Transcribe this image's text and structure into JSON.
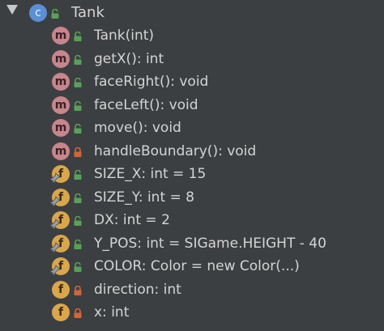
{
  "colors": {
    "background": "#3c3f41",
    "class_badge": "#5b8fd6",
    "method_badge": "#c8858c",
    "field_badge": "#d9a64c",
    "public_lock": "#58a158",
    "private_lock": "#d2663a",
    "text": "#d4d4d4"
  },
  "tree": {
    "class_node": {
      "expand_icon": "triangle-down-icon",
      "badge_letter": "c",
      "visibility": "public",
      "label": "Tank"
    },
    "members": [
      {
        "kind": "method",
        "badge_letter": "m",
        "visibility": "public",
        "final": false,
        "label": "Tank(int)"
      },
      {
        "kind": "method",
        "badge_letter": "m",
        "visibility": "public",
        "final": false,
        "label": "getX(): int"
      },
      {
        "kind": "method",
        "badge_letter": "m",
        "visibility": "public",
        "final": false,
        "label": "faceRight(): void"
      },
      {
        "kind": "method",
        "badge_letter": "m",
        "visibility": "public",
        "final": false,
        "label": "faceLeft(): void"
      },
      {
        "kind": "method",
        "badge_letter": "m",
        "visibility": "public",
        "final": false,
        "label": "move(): void"
      },
      {
        "kind": "method",
        "badge_letter": "m",
        "visibility": "private",
        "final": false,
        "label": "handleBoundary(): void"
      },
      {
        "kind": "field",
        "badge_letter": "f",
        "visibility": "public",
        "final": true,
        "label": "SIZE_X: int = 15"
      },
      {
        "kind": "field",
        "badge_letter": "f",
        "visibility": "public",
        "final": true,
        "label": "SIZE_Y: int = 8"
      },
      {
        "kind": "field",
        "badge_letter": "f",
        "visibility": "public",
        "final": true,
        "label": "DX: int = 2"
      },
      {
        "kind": "field",
        "badge_letter": "f",
        "visibility": "public",
        "final": true,
        "label": "Y_POS: int = SIGame.HEIGHT - 40"
      },
      {
        "kind": "field",
        "badge_letter": "f",
        "visibility": "public",
        "final": true,
        "label": "COLOR: Color = new Color(...)"
      },
      {
        "kind": "field",
        "badge_letter": "f",
        "visibility": "private",
        "final": false,
        "label": "direction: int"
      },
      {
        "kind": "field",
        "badge_letter": "f",
        "visibility": "private",
        "final": false,
        "label": "x: int"
      }
    ]
  }
}
